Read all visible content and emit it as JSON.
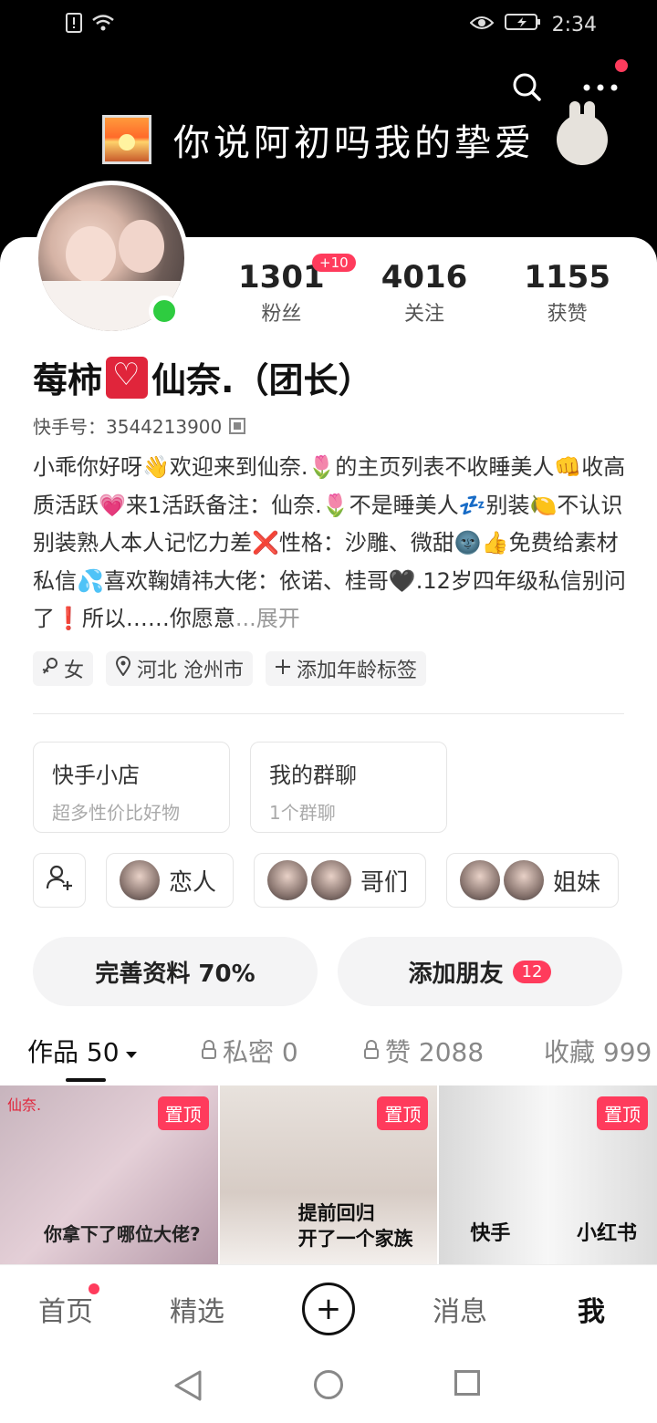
{
  "status": {
    "time": "2:34"
  },
  "banner": {
    "text": "你说阿初吗我的挚爱"
  },
  "stats": [
    {
      "num": "1301",
      "label": "粉丝",
      "badge": "+10"
    },
    {
      "num": "4016",
      "label": "关注"
    },
    {
      "num": "1155",
      "label": "获赞"
    }
  ],
  "profile": {
    "name_part1": "莓柿",
    "name_part2": "仙奈.（团长）",
    "kuaishou_id": "快手号：3544213900",
    "bio": "小乖你好呀👋欢迎来到仙奈.🌷的主页列表不收睡美人👊收高质活跃💗来1活跃备注：仙奈.🌷不是睡美人💤别装🍋不认识别装熟人本人记忆力差❌性格：沙雕、微甜🌚👍免费给素材私信💦喜欢鞠婧祎大佬：依诺、桂哥🖤.12岁四年级私信别问了❗所以……你愿意",
    "expand": "...展开"
  },
  "tags": [
    {
      "icon": "female-icon",
      "label": "女"
    },
    {
      "icon": "location-icon",
      "label": "河北 沧州市"
    },
    {
      "icon": "plus-icon",
      "label": "添加年龄标签"
    }
  ],
  "boxes": [
    {
      "title": "快手小店",
      "sub": "超多性价比好物"
    },
    {
      "title": "我的群聊",
      "sub": "1个群聊"
    }
  ],
  "relations": [
    {
      "label": "恋人"
    },
    {
      "label": "哥们"
    },
    {
      "label": "姐妹"
    }
  ],
  "actions": {
    "complete": "完善资料 70%",
    "add_friend": "添加朋友",
    "add_friend_count": "12"
  },
  "tabs": {
    "works": "作品 50",
    "private": "私密 0",
    "likes": "赞 2088",
    "favorites": "收藏 999"
  },
  "grid": {
    "pin_label": "置顶",
    "cell1_caption": "你拿下了哪位大佬?",
    "cell1_corner": "仙奈.",
    "cell2_caption_l1": "提前回归",
    "cell2_caption_l2": "开了一个家族",
    "cell3_left": "快手",
    "cell3_right": "小红书"
  },
  "nav": {
    "home": "首页",
    "featured": "精选",
    "plus": "+",
    "messages": "消息",
    "me": "我"
  },
  "colors": {
    "accent": "#ff3b5c",
    "online": "#2ecc40"
  }
}
